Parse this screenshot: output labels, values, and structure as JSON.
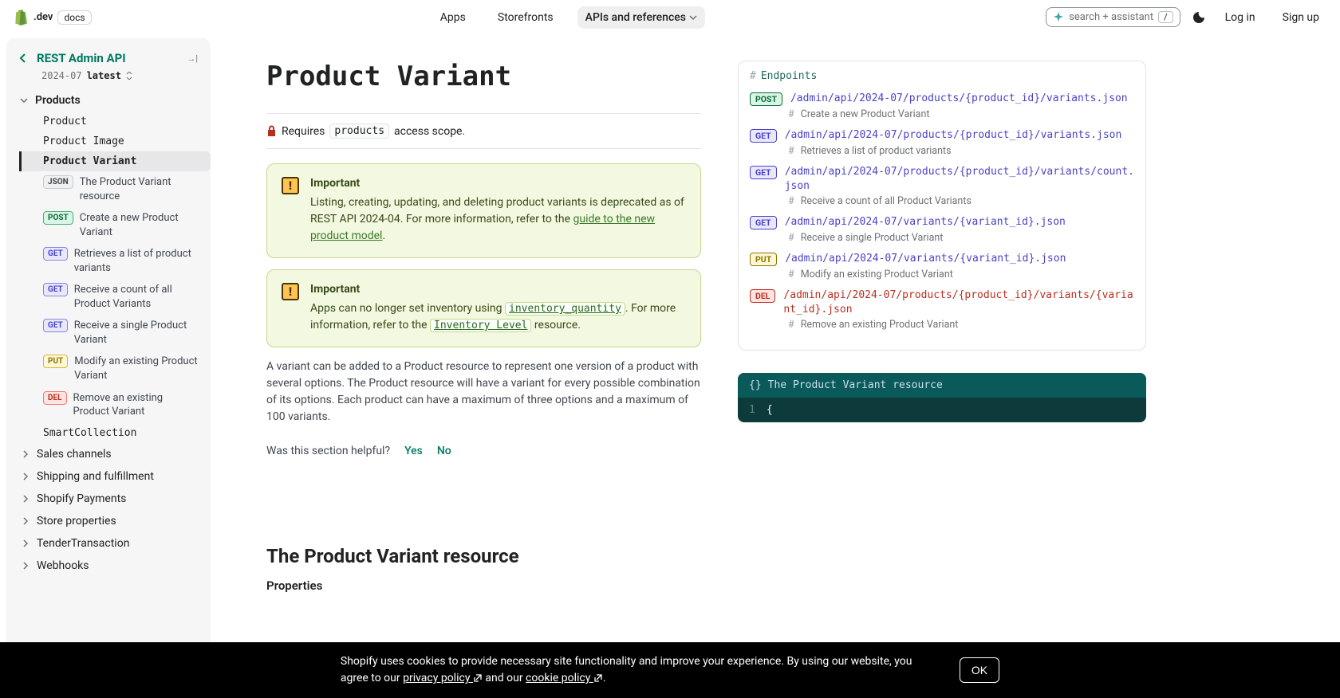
{
  "header": {
    "brand_dev": ".dev",
    "brand_docs": "docs",
    "nav": {
      "apps": "Apps",
      "storefronts": "Storefronts",
      "apis": "APIs and references"
    },
    "search": "search + assistant",
    "kbd": "/",
    "login": "Log in",
    "signup": "Sign up"
  },
  "sidebar": {
    "title": "REST Admin API",
    "version_code": "2024-07",
    "version_label": "latest",
    "section": "Products",
    "items": [
      "Product",
      "Product Image",
      "Product Variant",
      "SmartCollection"
    ],
    "subs": [
      {
        "tag": "JSON",
        "label": "The Product Variant resource"
      },
      {
        "tag": "POST",
        "label": "Create a new Product Variant"
      },
      {
        "tag": "GET",
        "label": "Retrieves a list of product variants"
      },
      {
        "tag": "GET",
        "label": "Receive a count of all Product Variants"
      },
      {
        "tag": "GET",
        "label": "Receive a single Product Variant"
      },
      {
        "tag": "PUT",
        "label": "Modify an existing Product Variant"
      },
      {
        "tag": "DEL",
        "label": "Remove an existing Product Variant"
      }
    ],
    "cats": [
      "Sales channels",
      "Shipping and fulfillment",
      "Shopify Payments",
      "Store properties",
      "TenderTransaction",
      "Webhooks"
    ]
  },
  "page": {
    "title": "Product Variant",
    "scope_prefix": "Requires",
    "scope_code": "products",
    "scope_suffix": "access scope.",
    "call1_title": "Important",
    "call1_body_a": "Listing, creating, updating, and deleting product variants is deprecated as of REST API 2024-04. For more information, refer to the ",
    "call1_link": "guide to the new product model",
    "call2_title": "Important",
    "call2_body_a": "Apps can no longer set inventory using ",
    "call2_code": "inventory_quantity",
    "call2_body_b": ". For more information, refer to the ",
    "call2_link": "Inventory Level",
    "call2_body_c": " resource.",
    "para": "A variant can be added to a Product resource to represent one version of a product with several options. The Product resource will have a variant for every possible combination of its options. Each product can have a maximum of three options and a maximum of 100 variants.",
    "feedback_q": "Was this section helpful?",
    "yes": "Yes",
    "no": "No",
    "h2": "The Product Variant resource",
    "props": "Properties"
  },
  "endpoints": {
    "title": "Endpoints",
    "list": [
      {
        "method": "POST",
        "cls": "tag-post",
        "path": "/admin/api/2024-07/products/{product_id}/variants.json",
        "desc": "Create a new Product Variant"
      },
      {
        "method": "GET",
        "cls": "tag-get",
        "path": "/admin/api/2024-07/products/{product_id}/variants.json",
        "desc": "Retrieves a list of product variants"
      },
      {
        "method": "GET",
        "cls": "tag-get",
        "path": "/admin/api/2024-07/products/{product_id}/variants/count.json",
        "desc": "Receive a count of all Product Variants"
      },
      {
        "method": "GET",
        "cls": "tag-get",
        "path": "/admin/api/2024-07/variants/{variant_id}.json",
        "desc": "Receive a single Product Variant"
      },
      {
        "method": "PUT",
        "cls": "tag-put",
        "path": "/admin/api/2024-07/variants/{variant_id}.json",
        "desc": "Modify an existing Product Variant"
      },
      {
        "method": "DEL",
        "cls": "tag-del",
        "path": "/admin/api/2024-07/products/{product_id}/variants/{variant_id}.json",
        "desc": "Remove an existing Product Variant",
        "del": true
      }
    ]
  },
  "code": {
    "title": "The Product Variant resource",
    "line1": "{"
  },
  "cookie": {
    "text_a": "Shopify uses cookies to provide necessary site functionality and improve your experience. By using our website, you agree to our ",
    "link1": "privacy policy",
    "text_b": " and our ",
    "link2": "cookie policy",
    "ok": "OK"
  }
}
